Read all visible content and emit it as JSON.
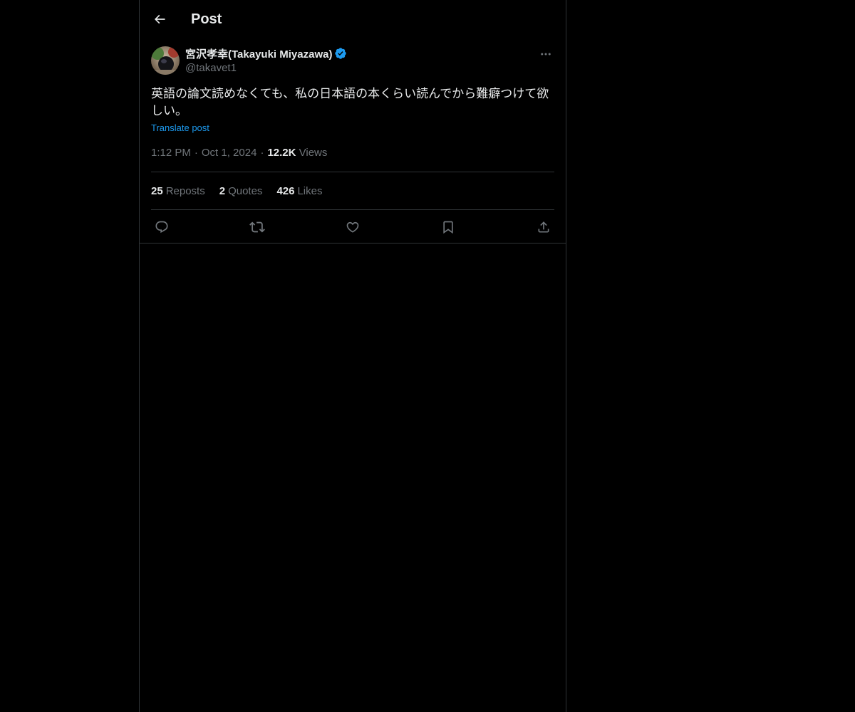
{
  "header": {
    "title": "Post"
  },
  "post": {
    "author": {
      "display_name": "宮沢孝幸(Takayuki Miyazawa)",
      "handle": "@takavet1",
      "verified": true
    },
    "text": "英語の論文読めなくても、私の日本語の本くらい読んでから難癖つけて欲しい。",
    "translate_label": "Translate post",
    "time": "1:12 PM",
    "date": "Oct 1, 2024",
    "views_count": "12.2K",
    "views_label": "Views",
    "separator": "·"
  },
  "stats": {
    "reposts": {
      "count": "25",
      "label": "Reposts"
    },
    "quotes": {
      "count": "2",
      "label": "Quotes"
    },
    "likes": {
      "count": "426",
      "label": "Likes"
    }
  },
  "icons": {
    "back": "arrow-left-icon",
    "verified": "verified-badge-icon",
    "more": "more-horizontal-icon",
    "reply": "reply-icon",
    "repost": "repost-icon",
    "like": "heart-icon",
    "bookmark": "bookmark-icon",
    "share": "share-icon"
  },
  "colors": {
    "background": "#000000",
    "text": "#e7e9ea",
    "muted": "#71767b",
    "accent": "#1d9bf0",
    "border": "#2f3336"
  }
}
